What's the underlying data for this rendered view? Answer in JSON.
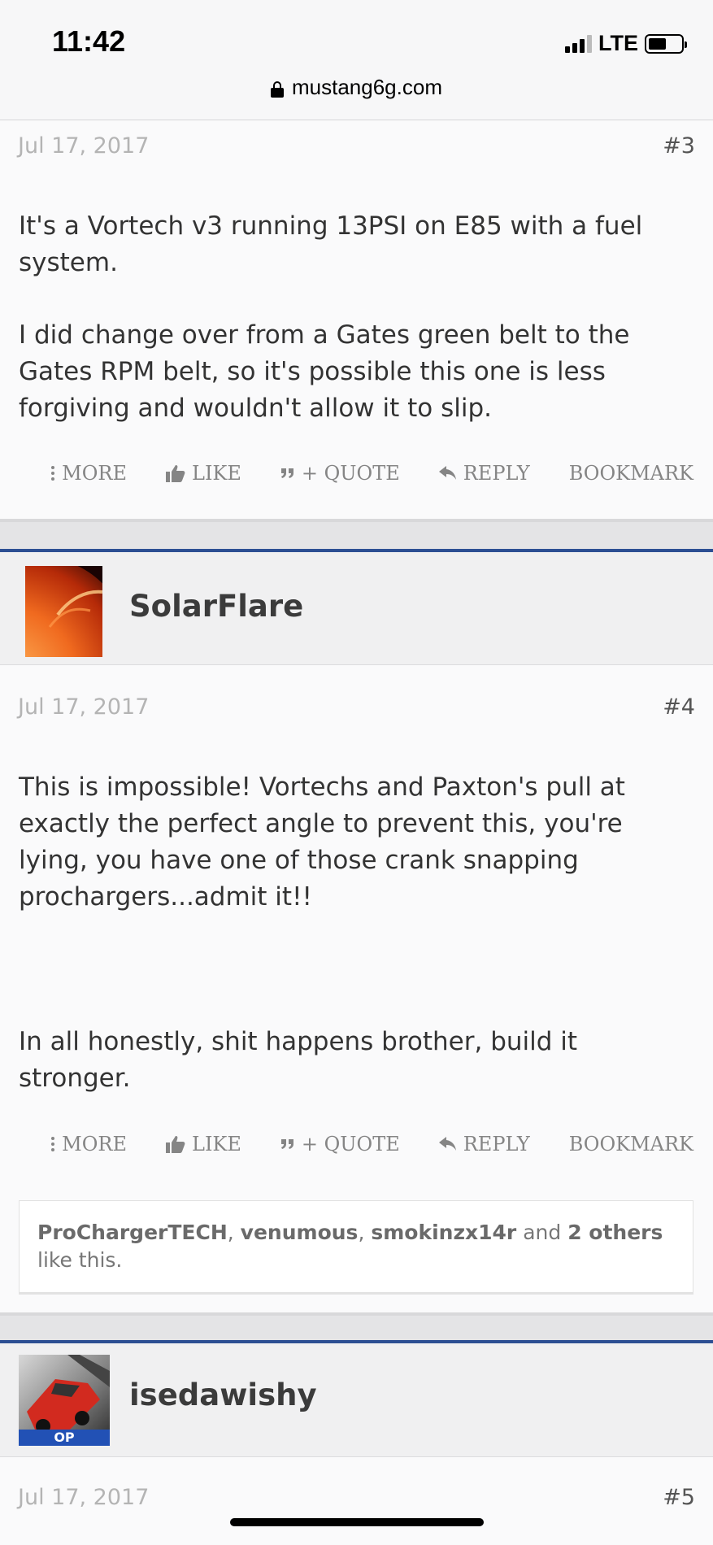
{
  "status_bar": {
    "time": "11:42",
    "network": "LTE"
  },
  "browser": {
    "url": "mustang6g.com"
  },
  "actions": {
    "more": "MORE",
    "like": "LIKE",
    "quote": "+ QUOTE",
    "reply": "REPLY",
    "bookmark": "BOOKMARK"
  },
  "posts": [
    {
      "date": "Jul 17, 2017",
      "number": "#3",
      "paragraphs": [
        "It's a Vortech v3 running 13PSI on E85 with a fuel system.",
        "I did change over from a Gates green belt to the Gates RPM belt, so it's possible this one is less forgiving and wouldn't allow it to slip."
      ]
    },
    {
      "author": "SolarFlare",
      "date": "Jul 17, 2017",
      "number": "#4",
      "paragraphs": [
        "This is impossible! Vortechs and Paxton's pull at exactly the perfect angle to prevent this, you're lying, you have one of those crank snapping prochargers...admit it!!",
        "In all honestly, shit happens brother, build it stronger."
      ],
      "likes": {
        "users": [
          "ProChargerTECH",
          "venumous",
          "smokinzx14r"
        ],
        "sep1": ", ",
        "sep2": ", ",
        "and_text": " and ",
        "others": "2 others",
        "suffix": " like this."
      }
    },
    {
      "author": "isedawishy",
      "badge": "OP",
      "date": "Jul 17, 2017",
      "number": "#5"
    }
  ],
  "colors": {
    "accent_bar": "#2c4f93",
    "date_gray": "#b4b4b4",
    "action_gray": "#858585"
  }
}
